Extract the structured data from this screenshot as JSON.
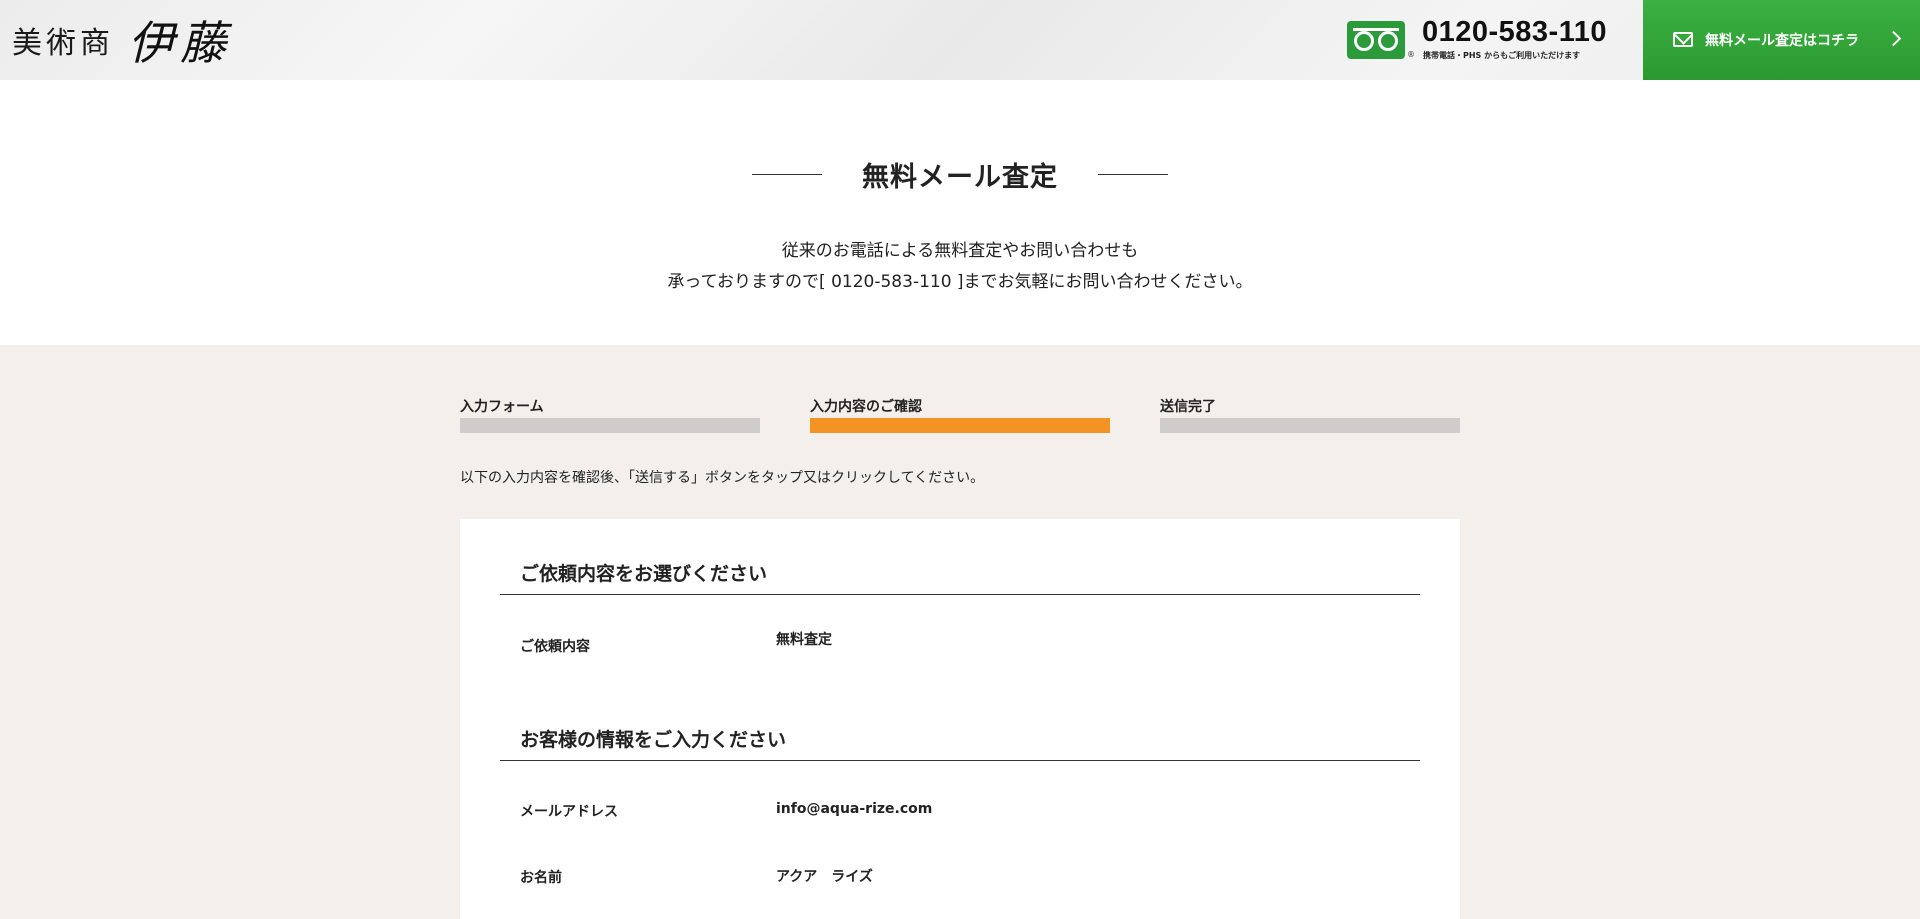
{
  "header": {
    "logo_small": "美術商",
    "logo_big": "伊藤",
    "phone_number": "0120-583-110",
    "phone_note": "携帯電話・PHS からもご利用いただけます",
    "reg_mark": "®",
    "mail_button_label": "無料メール査定はコチラ"
  },
  "main": {
    "title": "無料メール査定",
    "intro_line1": "従来のお電話による無料査定やお問い合わせも",
    "intro_line2": "承っておりますので[ 0120-583-110 ]までお気軽にお問い合わせください。"
  },
  "steps": [
    {
      "label": "入力フォーム",
      "active": false
    },
    {
      "label": "入力内容のご確認",
      "active": true
    },
    {
      "label": "送信完了",
      "active": false
    }
  ],
  "confirm_note": "以下の入力内容を確認後、「送信する」ボタンをタップ又はクリックしてください。",
  "form": {
    "section1_title": "ご依頼内容をお選びください",
    "section2_title": "お客様の情報をご入力ください",
    "rows": [
      {
        "label": "ご依頼内容",
        "value": "無料査定"
      },
      {
        "label": "メールアドレス",
        "value": "info@aqua-rize.com"
      },
      {
        "label": "お名前",
        "value": "アクア　ライズ"
      }
    ]
  },
  "colors": {
    "accent_green": "#3cb043",
    "step_active": "#f39324",
    "step_inactive": "#cfcccb",
    "section_bg": "#f4efea"
  }
}
